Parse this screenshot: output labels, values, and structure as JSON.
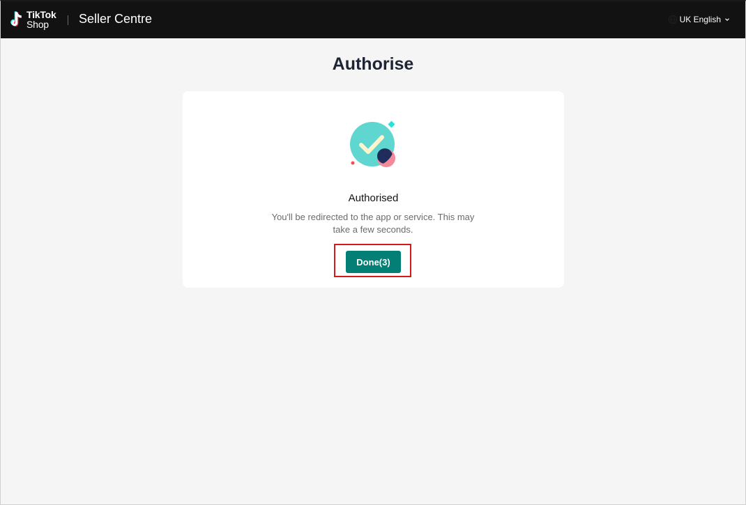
{
  "header": {
    "logo_line1": "TikTok",
    "logo_line2": "Shop",
    "product_name": "Seller Centre",
    "language": "UK English",
    "globe_icon": "globe-icon",
    "chevron_icon": "chevron-down-icon"
  },
  "page": {
    "title": "Authorise"
  },
  "card": {
    "illustration_icon": "success-check-icon",
    "status_title": "Authorised",
    "description": "You'll be redirected to the app or service. This may take a few seconds.",
    "done_label": "Done(3)"
  },
  "colors": {
    "topbar": "#121212",
    "primary_button": "#047f76",
    "highlight_border": "#d6171c",
    "check_circle": "#5fd6d0",
    "check_mark": "#fff5cc",
    "accent_navy": "#1f2d5c",
    "accent_pink": "#f28a9a",
    "accent_cyan": "#22e3de",
    "background": "#f5f5f5"
  }
}
